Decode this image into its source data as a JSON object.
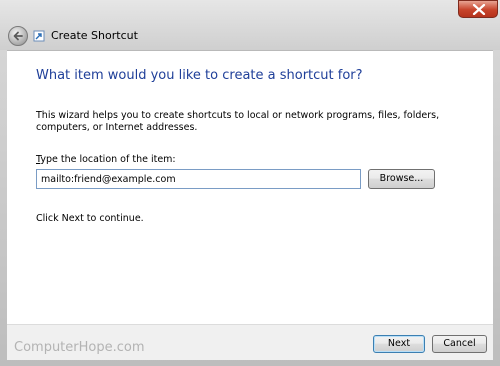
{
  "window": {
    "title": "Create Shortcut"
  },
  "wizard": {
    "heading": "What item would you like to create a shortcut for?",
    "description": "This wizard helps you to create shortcuts to local or network programs, files, folders, computers, or Internet addresses.",
    "location_label_first": "T",
    "location_label_rest": "ype the location of the item:",
    "location_value": "mailto:friend@example.com",
    "browse_label": "Browse...",
    "hint": "Click Next to continue."
  },
  "buttons": {
    "next": "Next",
    "cancel": "Cancel"
  },
  "watermark": "ComputerHope.com",
  "colors": {
    "heading": "#1f3f99",
    "close_button": "#c7432a",
    "input_border": "#7a9cc5"
  }
}
